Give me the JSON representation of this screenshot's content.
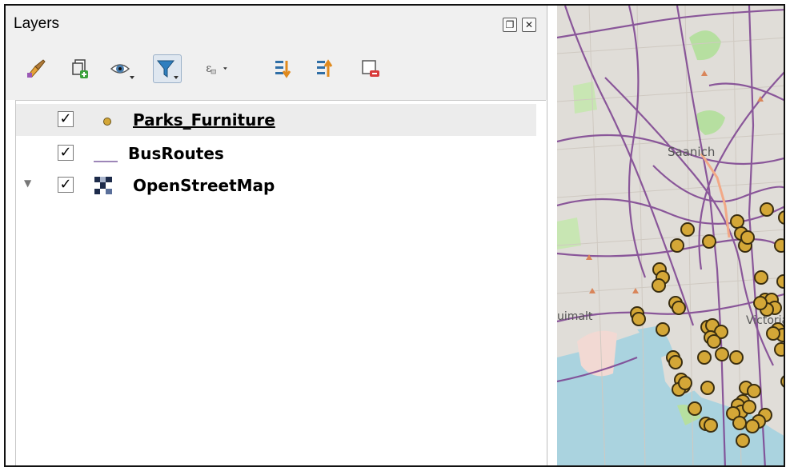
{
  "panel": {
    "title": "Layers",
    "float_icon": "float-restore-icon",
    "close_icon": "close-icon"
  },
  "toolbar": [
    {
      "name": "style-manager-icon"
    },
    {
      "name": "add-group-icon"
    },
    {
      "name": "manage-visibility-icon"
    },
    {
      "name": "filter-legend-icon",
      "active": true
    },
    {
      "name": "filter-by-expression-icon"
    },
    {
      "name": "expand-all-icon"
    },
    {
      "name": "collapse-all-icon"
    },
    {
      "name": "remove-layer-icon"
    }
  ],
  "layers": [
    {
      "label": "Parks_Furniture",
      "checked": true,
      "check_glyph": "✓",
      "symbol": "point",
      "selected": true
    },
    {
      "label": "BusRoutes",
      "checked": true,
      "check_glyph": "✓",
      "symbol": "line"
    },
    {
      "label": "OpenStreetMap",
      "checked": true,
      "check_glyph": "✓",
      "symbol": "raster",
      "expander": "▼"
    }
  ],
  "map": {
    "labels": {
      "saanich": "Saanich",
      "esquimalt": "uimalt",
      "victoria": "Victoria"
    },
    "colors": {
      "point_fill": "#d4a737",
      "point_stroke": "#3a2e10",
      "route": "#7b3f8f",
      "water": "#aad3df",
      "park": "#b6dfa0",
      "urban": "#e0ddd8"
    }
  }
}
